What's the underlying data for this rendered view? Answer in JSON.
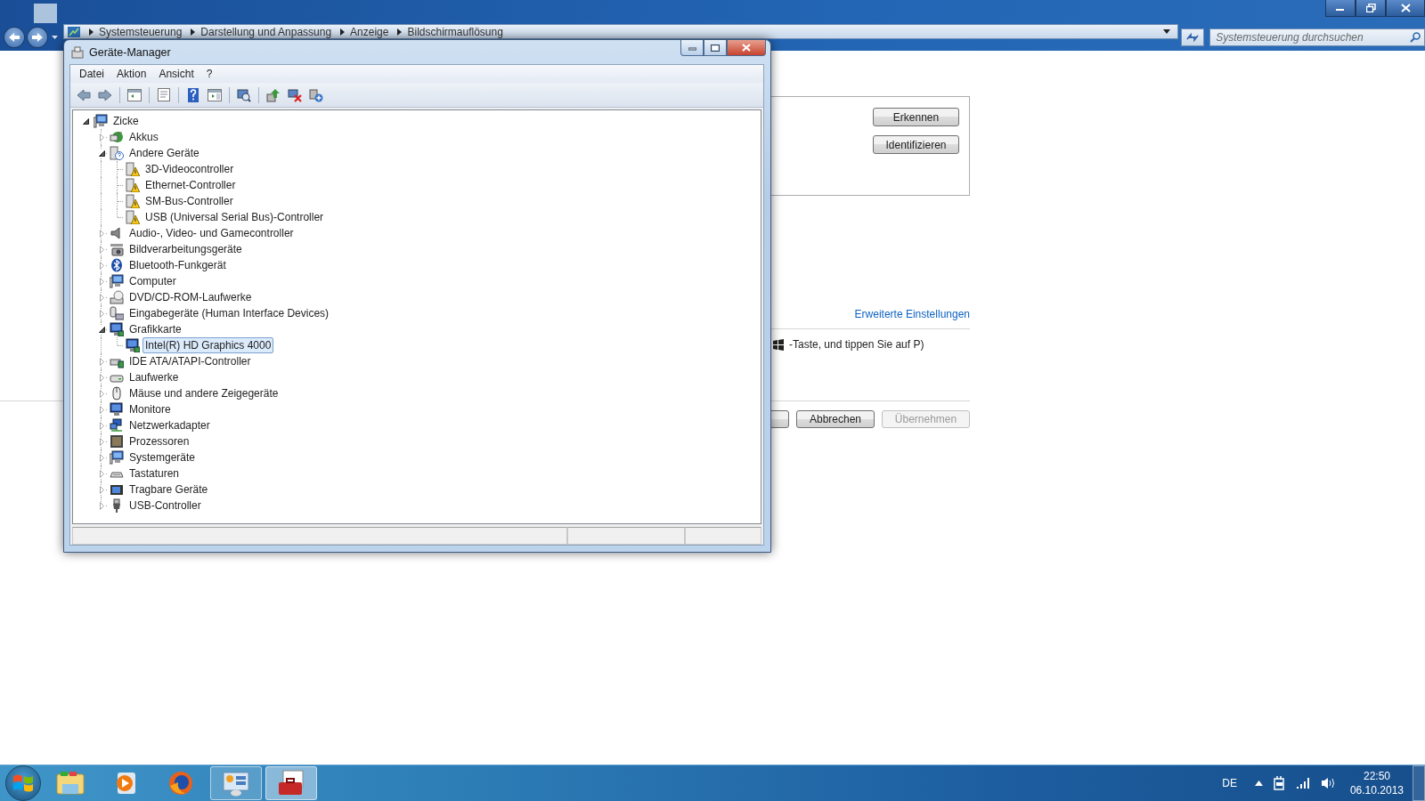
{
  "explorer": {
    "breadcrumb": [
      "Systemsteuerung",
      "Darstellung und Anpassung",
      "Anzeige",
      "Bildschirmauflösung"
    ],
    "search": {
      "placeholder": "Systemsteuerung durchsuchen"
    }
  },
  "display_settings": {
    "buttons": [
      {
        "label": "Erkennen",
        "disabled": false
      },
      {
        "label": "Identifizieren",
        "disabled": false
      }
    ],
    "link": "Erweiterte Einstellungen",
    "hint": "-Taste, und tippen Sie auf P)",
    "footer_buttons": [
      {
        "label": "Abbrechen",
        "disabled": false
      },
      {
        "label": "Übernehmen",
        "disabled": true
      }
    ]
  },
  "device_manager": {
    "title": "Geräte-Manager",
    "menu": [
      "Datei",
      "Aktion",
      "Ansicht",
      "?"
    ],
    "tree": {
      "label": "Zicke",
      "kind": "computer",
      "expanded": true,
      "selected": false,
      "children": [
        {
          "label": "Akkus",
          "kind": "battery",
          "expanded": false,
          "selected": false
        },
        {
          "label": "Andere Geräte",
          "kind": "unknown",
          "expanded": true,
          "selected": false,
          "children": [
            {
              "label": "3D-Videocontroller",
              "kind": "warning",
              "selected": false
            },
            {
              "label": "Ethernet-Controller",
              "kind": "warning",
              "selected": false
            },
            {
              "label": "SM-Bus-Controller",
              "kind": "warning",
              "selected": false
            },
            {
              "label": "USB (Universal Serial Bus)-Controller",
              "kind": "warning",
              "selected": false
            }
          ]
        },
        {
          "label": "Audio-, Video- und Gamecontroller",
          "kind": "audio",
          "expanded": false,
          "selected": false
        },
        {
          "label": "Bildverarbeitungsgeräte",
          "kind": "imaging",
          "expanded": false,
          "selected": false
        },
        {
          "label": "Bluetooth-Funkgerät",
          "kind": "bluetooth",
          "expanded": false,
          "selected": false
        },
        {
          "label": "Computer",
          "kind": "computer",
          "expanded": false,
          "selected": false
        },
        {
          "label": "DVD/CD-ROM-Laufwerke",
          "kind": "optical",
          "expanded": false,
          "selected": false
        },
        {
          "label": "Eingabegeräte (Human Interface Devices)",
          "kind": "hid",
          "expanded": false,
          "selected": false
        },
        {
          "label": "Grafikkarte",
          "kind": "display",
          "expanded": true,
          "selected": false,
          "children": [
            {
              "label": "Intel(R) HD Graphics 4000",
              "kind": "display",
              "selected": true
            }
          ]
        },
        {
          "label": "IDE ATA/ATAPI-Controller",
          "kind": "ide",
          "expanded": false,
          "selected": false
        },
        {
          "label": "Laufwerke",
          "kind": "drive",
          "expanded": false,
          "selected": false
        },
        {
          "label": "Mäuse und andere Zeigegeräte",
          "kind": "mouse",
          "expanded": false,
          "selected": false
        },
        {
          "label": "Monitore",
          "kind": "monitor",
          "expanded": false,
          "selected": false
        },
        {
          "label": "Netzwerkadapter",
          "kind": "network",
          "expanded": false,
          "selected": false
        },
        {
          "label": "Prozessoren",
          "kind": "cpu",
          "expanded": false,
          "selected": false
        },
        {
          "label": "Systemgeräte",
          "kind": "computer",
          "expanded": false,
          "selected": false
        },
        {
          "label": "Tastaturen",
          "kind": "keyboard",
          "expanded": false,
          "selected": false
        },
        {
          "label": "Tragbare Geräte",
          "kind": "portable",
          "expanded": false,
          "selected": false
        },
        {
          "label": "USB-Controller",
          "kind": "usb",
          "expanded": false,
          "selected": false
        }
      ]
    }
  },
  "taskbar": {
    "buttons": [
      {
        "kind": "explorer",
        "running": false,
        "selected": false
      },
      {
        "kind": "media",
        "running": false,
        "selected": false
      },
      {
        "kind": "firefox",
        "running": false,
        "selected": false
      },
      {
        "kind": "control_panel",
        "running": true,
        "selected": false
      },
      {
        "kind": "device_manager",
        "running": true,
        "selected": true
      }
    ],
    "language": "DE",
    "time": "22:50",
    "date": "06.10.2013"
  }
}
